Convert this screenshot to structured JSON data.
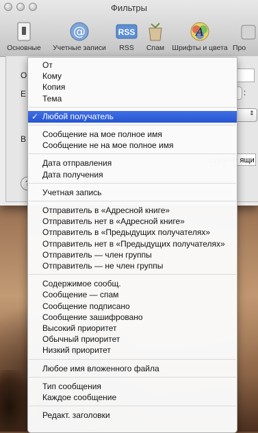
{
  "window": {
    "title": "Фильтры",
    "toolbar": [
      {
        "label": "Основные",
        "icon": "switch-icon"
      },
      {
        "label": "Учетные записи",
        "icon": "at-sign-icon"
      },
      {
        "label": "RSS",
        "icon": "rss-icon"
      },
      {
        "label": "Спам",
        "icon": "spam-trash-icon"
      },
      {
        "label": "Шрифты и цвета",
        "icon": "font-color-icon"
      },
      {
        "label": "Про",
        "icon": "more-icon"
      }
    ]
  },
  "background": {
    "row1_fragment": "О",
    "row2_fragment": "Е",
    "row2_end": ":",
    "row3_fragment": "В",
    "row3_right": "с другой ящи",
    "help_symbol": "?"
  },
  "menu": {
    "selected_check": "✓",
    "groups": [
      [
        "От",
        "Кому",
        "Копия",
        "Тема"
      ],
      [
        "Любой получатель"
      ],
      [
        "Сообщение на мое полное имя",
        "Сообщение не на мое полное имя"
      ],
      [
        "Дата отправления",
        "Дата получения"
      ],
      [
        "Учетная запись"
      ],
      [
        "Отправитель в «Адресной книге»",
        "Отправитель нет в «Адресной книге»",
        "Отправитель в «Предыдущих получателях»",
        "Отправитель нет в «Предыдущих получателях»",
        "Отправитель — член группы",
        "Отправитель — не член группы"
      ],
      [
        "Содержимое сообщ.",
        "Сообщение — спам",
        "Сообщение подписано",
        "Сообщение зашифровано",
        "Высокий приоритет",
        "Обычный приоритет",
        "Низкий приоритет"
      ],
      [
        "Любое имя вложенного файла"
      ],
      [
        "Тип сообщения",
        "Каждое сообщение"
      ],
      [
        "Редакт. заголовки"
      ]
    ],
    "selected_item": "Любой получатель"
  }
}
